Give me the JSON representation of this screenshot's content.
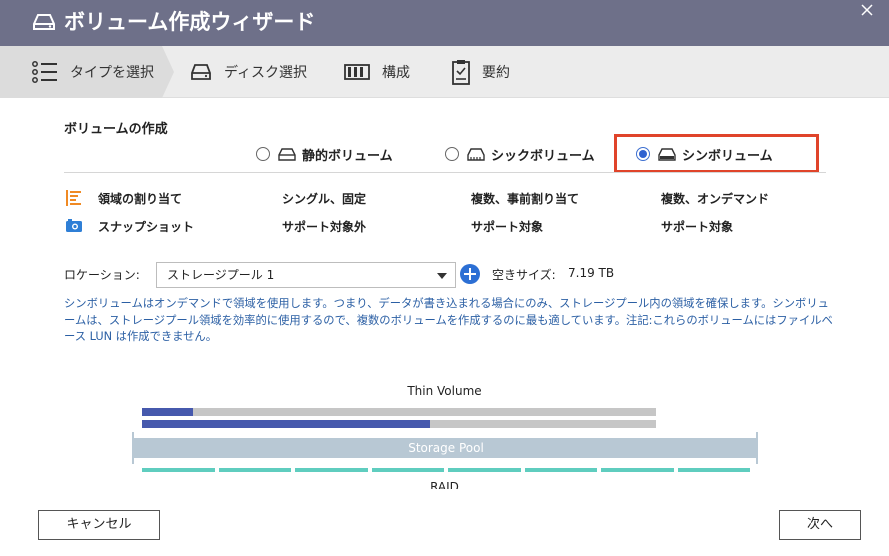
{
  "window": {
    "title": "ボリューム作成ウィザード"
  },
  "steps": [
    {
      "label": "タイプを選択",
      "icon": "list-icon"
    },
    {
      "label": "ディスク選択",
      "icon": "disk-icon"
    },
    {
      "label": "構成",
      "icon": "config-icon"
    },
    {
      "label": "要約",
      "icon": "summary-icon"
    }
  ],
  "section": {
    "title": "ボリュームの作成"
  },
  "volume_types": [
    {
      "label": "静的ボリューム",
      "selected": false
    },
    {
      "label": "シックボリューム",
      "selected": false
    },
    {
      "label": "シンボリューム",
      "selected": true
    }
  ],
  "features": [
    {
      "label": "領域の割り当て",
      "icon": "allocation-icon",
      "static": "シングル、固定",
      "thick": "複数、事前割り当て",
      "thin": "複数、オンデマンド"
    },
    {
      "label": "スナップショット",
      "icon": "camera-icon",
      "static": "サポート対象外",
      "thick": "サポート対象",
      "thin": "サポート対象"
    }
  ],
  "location": {
    "label": "ロケーション:",
    "value": "ストレージプール 1",
    "free_label": "空きサイズ:",
    "free_value": "7.19 TB"
  },
  "description": "シンボリュームはオンデマンドで領域を使用します。つまり、データが書き込まれる場合にのみ、ストレージプール内の領域を確保します。シンボリュームは、ストレージプール領域を効率的に使用するので、複数のボリュームを作成するのに最も適しています。注記:これらのボリュームにはファイルベース LUN は作成できません。",
  "diagram": {
    "title": "Thin Volume",
    "pool_label": "Storage Pool",
    "raid_label": "RAID",
    "bar1_fill": 0.1,
    "bar2_fill": 0.56,
    "raid_segments": 8
  },
  "buttons": {
    "cancel": "キャンセル",
    "next": "次へ"
  },
  "colors": {
    "titlebar": "#6e7089",
    "accent": "#2c6fd4",
    "highlight": "#e0442a",
    "description": "#2b5fa4",
    "raid": "#5fcdbf"
  }
}
